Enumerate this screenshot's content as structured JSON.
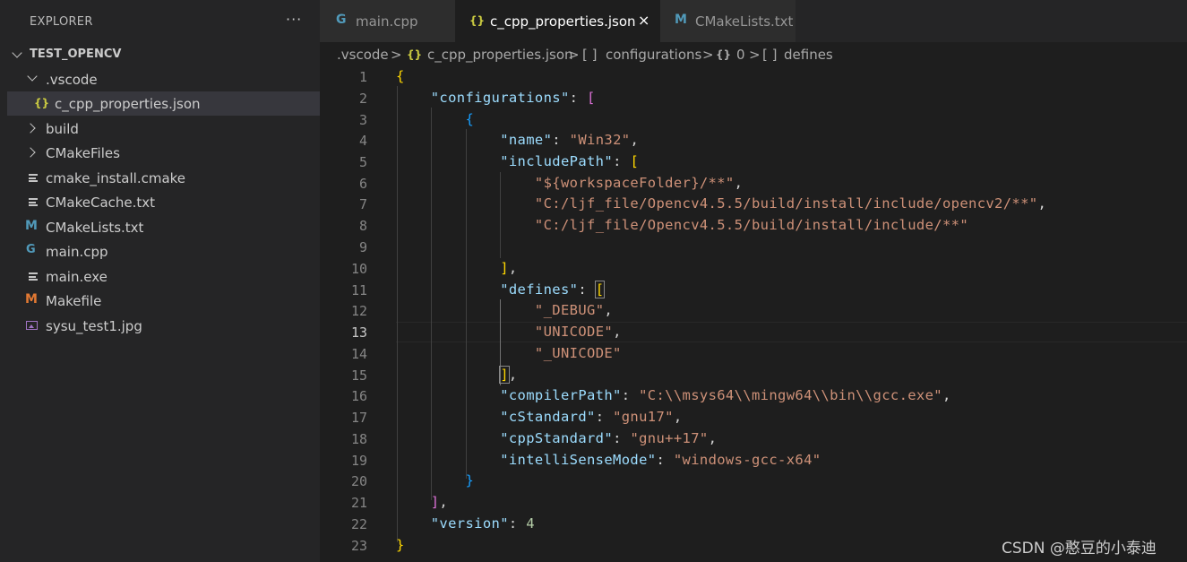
{
  "explorer": {
    "title": "EXPLORER",
    "more": "···",
    "root": "TEST_OPENCV",
    "items": [
      {
        "label": ".vscode",
        "icon": "chevron-down-icon"
      },
      {
        "label": "c_cpp_properties.json",
        "icon": "json-braces-icon",
        "glyph": "{}"
      },
      {
        "label": "build",
        "icon": "chevron-right-icon"
      },
      {
        "label": "CMakeFiles",
        "icon": "chevron-right-icon"
      },
      {
        "label": "cmake_install.cmake",
        "icon": "lines-file-icon"
      },
      {
        "label": "CMakeCache.txt",
        "icon": "lines-file-icon"
      },
      {
        "label": "CMakeLists.txt",
        "icon": "m-file-icon",
        "glyph": "M"
      },
      {
        "label": "main.cpp",
        "icon": "cpp-file-icon",
        "glyph": "G"
      },
      {
        "label": "main.exe",
        "icon": "lines-file-icon"
      },
      {
        "label": "Makefile",
        "icon": "m-file-icon",
        "glyph": "M"
      },
      {
        "label": "sysu_test1.jpg",
        "icon": "image-file-icon"
      }
    ]
  },
  "tabs": [
    {
      "label": "main.cpp",
      "glyph": "G"
    },
    {
      "label": "c_cpp_properties.json",
      "glyph": "{}",
      "close": "×"
    },
    {
      "label": "CMakeLists.txt",
      "glyph": "M"
    }
  ],
  "breadcrumb": {
    "p1": ".vscode",
    "sep": ">",
    "p2_icon": "{}",
    "p2": "c_cpp_properties.json",
    "p3_icon": "[ ]",
    "p3": "configurations",
    "p4_icon": "{}",
    "p4": "0",
    "p5_icon": "[ ]",
    "p5": "defines"
  },
  "code": {
    "line_numbers": [
      "1",
      "2",
      "3",
      "4",
      "5",
      "6",
      "7",
      "8",
      "9",
      "10",
      "11",
      "12",
      "13",
      "14",
      "15",
      "16",
      "17",
      "18",
      "19",
      "20",
      "21",
      "22",
      "23"
    ],
    "current_line": "13",
    "configurations_key": "\"configurations\"",
    "name_key": "\"name\"",
    "name_val": "\"Win32\"",
    "includePath_key": "\"includePath\"",
    "include_1": "\"${workspaceFolder}/**\"",
    "include_2": "\"C:/ljf_file/Opencv4.5.5/build/install/include/opencv2/**\"",
    "include_3": "\"C:/ljf_file/Opencv4.5.5/build/install/include/**\"",
    "defines_key": "\"defines\"",
    "define_1": "\"_DEBUG\"",
    "define_2": "\"UNICODE\"",
    "define_3": "\"_UNICODE\"",
    "compilerPath_key": "\"compilerPath\"",
    "compilerPath_val": "\"C:\\\\msys64\\\\mingw64\\\\bin\\\\gcc.exe\"",
    "cStandard_key": "\"cStandard\"",
    "cStandard_val": "\"gnu17\"",
    "cppStandard_key": "\"cppStandard\"",
    "cppStandard_val": "\"gnu++17\"",
    "intelliSenseMode_key": "\"intelliSenseMode\"",
    "intelliSenseMode_val": "\"windows-gcc-x64\"",
    "version_key": "\"version\"",
    "version_val": "4"
  },
  "watermark": "CSDN @憨豆的小泰迪",
  "colors": {
    "editor_bg": "#1e1e1e",
    "sidebar_bg": "#252526",
    "key": "#9cdcfe",
    "string": "#ce9178",
    "number": "#b5cea8"
  }
}
